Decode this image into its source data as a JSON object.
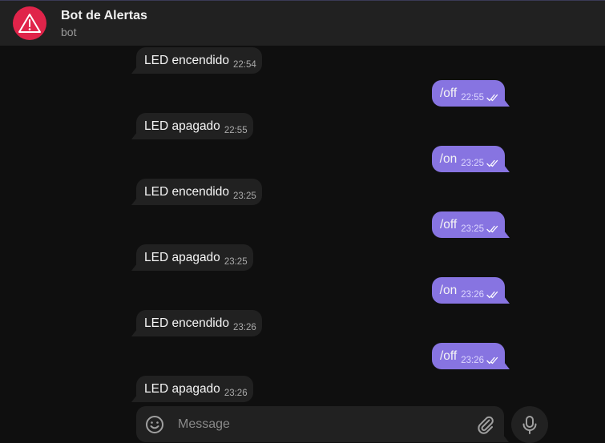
{
  "header": {
    "title": "Bot de Alertas",
    "subtitle": "bot",
    "avatar_icon": "warning-triangle-icon",
    "avatar_color": "#e0244a"
  },
  "messages": [
    {
      "dir": "in",
      "text": "LED encendido",
      "time": "22:54"
    },
    {
      "dir": "out",
      "text": "/off",
      "time": "22:55"
    },
    {
      "dir": "in",
      "text": "LED apagado",
      "time": "22:55"
    },
    {
      "dir": "out",
      "text": "/on",
      "time": "23:25"
    },
    {
      "dir": "in",
      "text": "LED encendido",
      "time": "23:25"
    },
    {
      "dir": "out",
      "text": "/off",
      "time": "23:25"
    },
    {
      "dir": "in",
      "text": "LED apagado",
      "time": "23:25"
    },
    {
      "dir": "out",
      "text": "/on",
      "time": "23:26"
    },
    {
      "dir": "in",
      "text": "LED encendido",
      "time": "23:26"
    },
    {
      "dir": "out",
      "text": "/off",
      "time": "23:26"
    },
    {
      "dir": "in",
      "text": "LED apagado",
      "time": "23:26"
    }
  ],
  "composer": {
    "placeholder": "Message",
    "emoji_icon": "smiley-icon",
    "attach_icon": "paperclip-icon",
    "mic_icon": "microphone-icon"
  },
  "colors": {
    "accent": "#8774e1",
    "bubble_in": "#212121",
    "background": "#0f0f0f"
  }
}
